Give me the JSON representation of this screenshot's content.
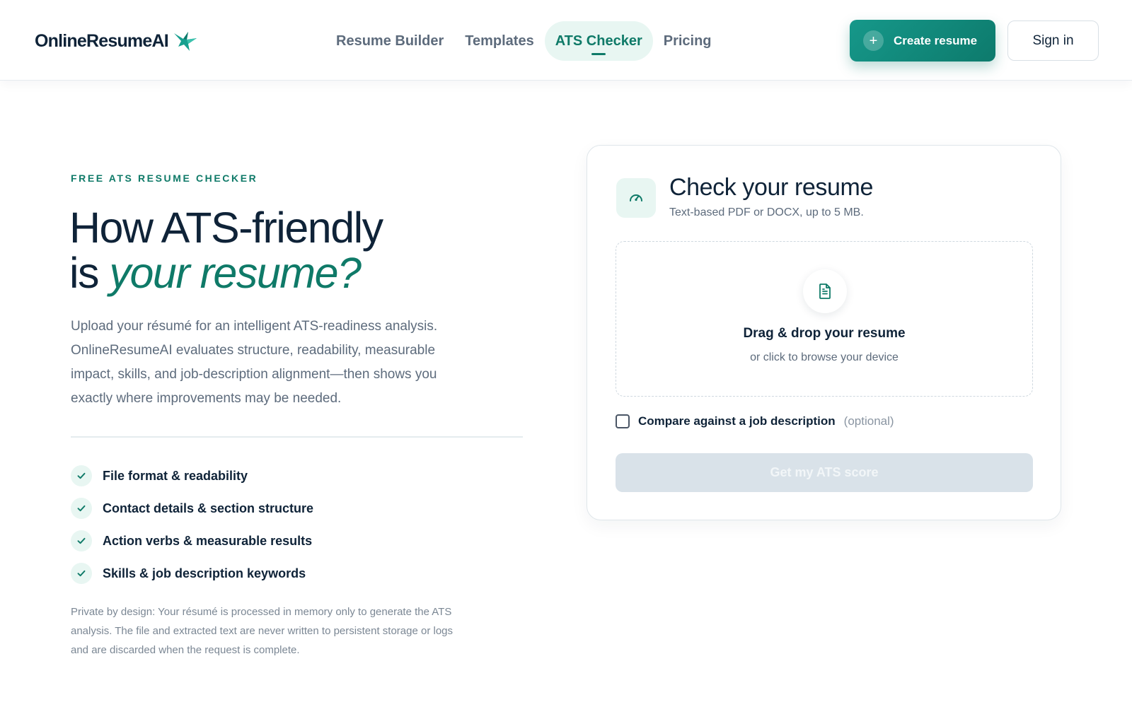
{
  "brand": {
    "name": "OnlineResumeAI",
    "accent_color": "#0f7a68"
  },
  "nav": {
    "items": [
      {
        "label": "Resume Builder"
      },
      {
        "label": "Templates"
      },
      {
        "label": "ATS Checker",
        "active": true
      },
      {
        "label": "Pricing"
      }
    ]
  },
  "header_actions": {
    "create_label": "Create resume",
    "create_icon": "plus-icon",
    "signin_label": "Sign in"
  },
  "hero": {
    "eyebrow": "FREE ATS RESUME CHECKER",
    "title_line1": "How ATS-friendly",
    "title_line2_prefix": "is ",
    "title_line2_accent": "your resume?",
    "description": "Upload your résumé for an intelligent ATS-readiness analysis. OnlineResumeAI evaluates structure, readability, measurable impact, skills, and job-description alignment—then shows you exactly where improvements may be needed.",
    "checklist": [
      {
        "label": "File format & readability"
      },
      {
        "label": "Contact details & section structure"
      },
      {
        "label": "Action verbs & measurable results"
      },
      {
        "label": "Skills & job description keywords"
      }
    ],
    "privacy_note": "Private by design: Your résumé is processed in memory only to generate the ATS analysis. The file and extracted text are never written to persistent storage or logs and are discarded when the request is complete."
  },
  "card": {
    "icon": "gauge-icon",
    "title": "Check your resume",
    "subtitle": "Text-based PDF or DOCX, up to 5 MB.",
    "dropzone": {
      "icon": "document-icon",
      "title": "Drag & drop your resume",
      "subtitle": "or click to browse your device"
    },
    "compare": {
      "label": "Compare against a job description",
      "optional_label": "(optional)",
      "checked": false
    },
    "submit_label": "Get my ATS score",
    "submit_disabled": true
  }
}
